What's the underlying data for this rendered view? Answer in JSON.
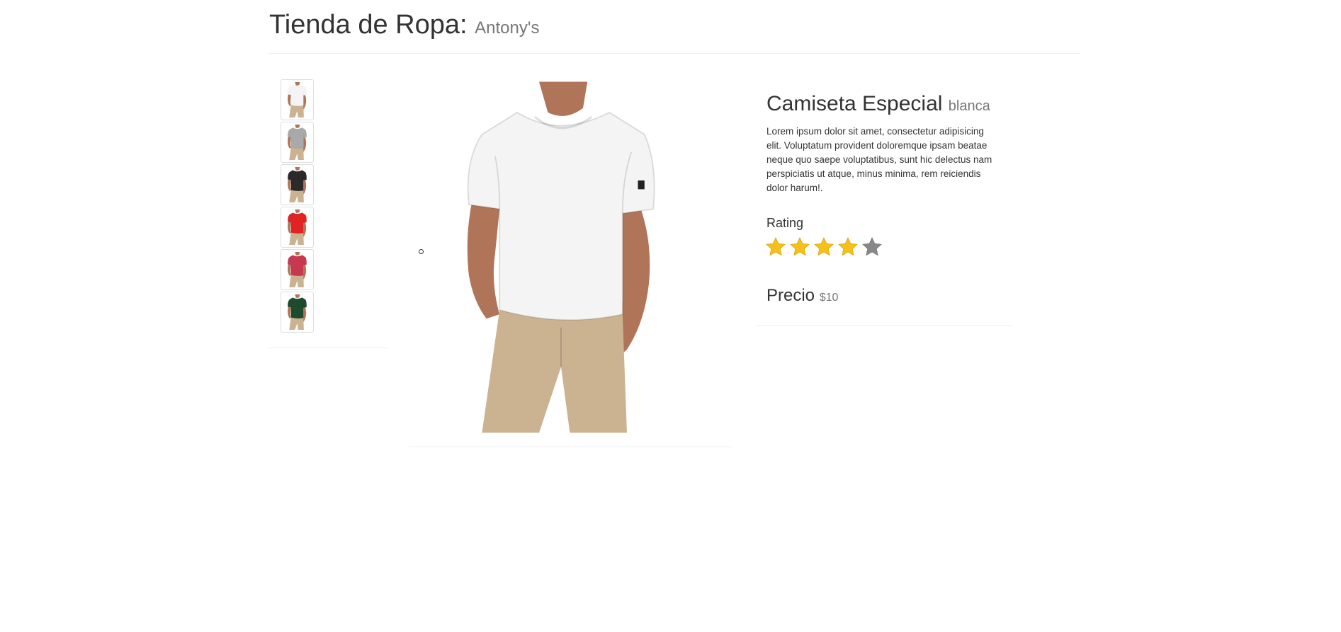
{
  "header": {
    "title": "Tienda de Ropa:",
    "subtitle": "Antony's"
  },
  "thumbnails": [
    {
      "name": "white-shirt-thumbnail",
      "shirt_color": "#f4f4f4"
    },
    {
      "name": "gray-shirt-thumbnail",
      "shirt_color": "#a9a9a9"
    },
    {
      "name": "black-shirt-thumbnail",
      "shirt_color": "#2a2a2a"
    },
    {
      "name": "red-shirt-thumbnail",
      "shirt_color": "#e02424"
    },
    {
      "name": "pink-shirt-thumbnail",
      "shirt_color": "#c8384f"
    },
    {
      "name": "green-shirt-thumbnail",
      "shirt_color": "#1e4a2e"
    }
  ],
  "product": {
    "name": "Camiseta Especial",
    "variant": "blanca",
    "description": "Lorem ipsum dolor sit amet, consectetur adipisicing elit. Voluptatum provident doloremque ipsam beatae neque quo saepe voluptatibus, sunt hic delectus nam perspiciatis ut atque, minus minima, rem reiciendis dolor harum!.",
    "rating_label": "Rating",
    "rating": 4,
    "rating_max": 5,
    "price_label": "Precio",
    "price": "$10"
  },
  "colors": {
    "star_filled": "#f5c01a",
    "star_empty": "#888888",
    "pants": "#cbb392",
    "skin": "#b07458"
  }
}
